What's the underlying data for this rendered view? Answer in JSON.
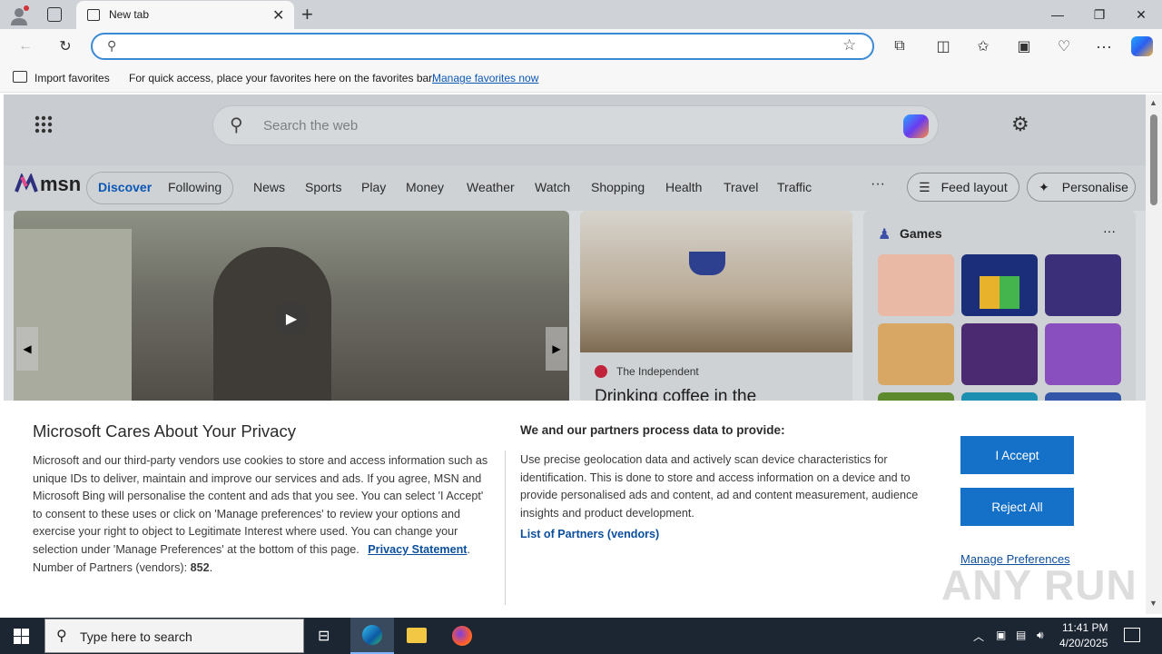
{
  "browser": {
    "tab_title": "New tab",
    "new_tab_symbol": "+",
    "address_value": "",
    "favbar": {
      "import_label": "Import favorites",
      "hint": "For quick access, place your favorites here on the favorites bar.",
      "manage_link": "Manage favorites now"
    }
  },
  "msn": {
    "search_placeholder": "Search the web",
    "logo_text": "msn",
    "tabs": [
      "Discover",
      "Following"
    ],
    "nav": [
      "News",
      "Sports",
      "Play",
      "Money",
      "Weather",
      "Watch",
      "Shopping",
      "Health",
      "Travel",
      "Traffic"
    ],
    "more": "···",
    "feed_layout": "Feed layout",
    "personalise": "Personalise",
    "card2_source": "The Independent",
    "card2_headline": "Drinking coffee in the",
    "games_title": "Games",
    "games_more": "···"
  },
  "privacy": {
    "title": "Microsoft Cares About Your Privacy",
    "body": "Microsoft and our third-party vendors use cookies to store and access information such as unique IDs to deliver, maintain and improve our services and ads. If you agree, MSN and Microsoft Bing will personalise the content and ads that you see. You can select 'I Accept' to consent to these uses or click on 'Manage preferences' to review your options and exercise your right to object to Legitimate Interest where used.  You can change your selection under 'Manage Preferences' at the bottom of this page.",
    "privacy_link": "Privacy Statement",
    "partners_label": "Number of Partners (vendors):",
    "partners_count": "852",
    "title2": "We and our partners process data to provide:",
    "body2": "Use precise geolocation data and actively scan device characteristics for identification. This is done to store and access information on a device and to provide personalised ads and content, ad and content measurement, audience insights and product development.",
    "partners_link": "List of Partners (vendors)",
    "accept": "I Accept",
    "reject": "Reject All",
    "manage": "Manage Preferences"
  },
  "taskbar": {
    "search_placeholder": "Type here to search",
    "time": "11:41 PM",
    "date": "4/20/2025"
  },
  "watermark": "ANY RUN",
  "colors": {
    "accent": "#1570c7",
    "link": "#0b4f9c",
    "taskbar": "#1c2633"
  }
}
